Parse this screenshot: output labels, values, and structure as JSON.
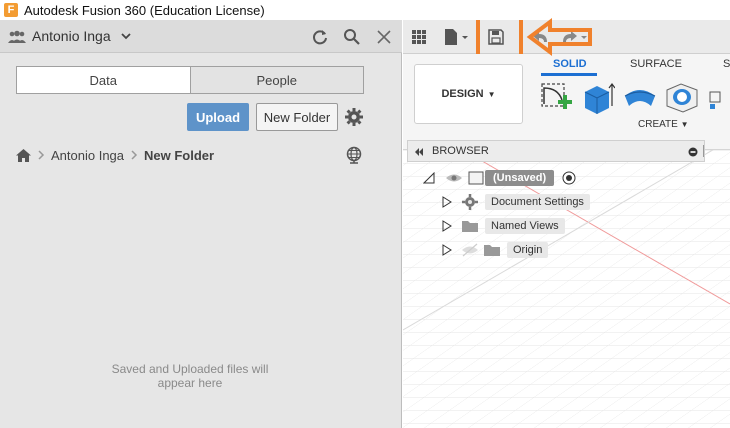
{
  "window": {
    "title": "Autodesk Fusion 360 (Education License)",
    "logo_letter": "F"
  },
  "data_panel": {
    "user_name": "Antonio Inga",
    "tabs": [
      {
        "label": "Data",
        "active": true
      },
      {
        "label": "People",
        "active": false
      }
    ],
    "upload_label": "Upload",
    "new_folder_label": "New Folder",
    "breadcrumb": [
      {
        "label": "Antonio Inga"
      },
      {
        "label": "New Folder"
      }
    ],
    "empty_message_line1": "Saved and Uploaded files will",
    "empty_message_line2": "appear here"
  },
  "toolbar": {
    "design_label": "DESIGN",
    "ribbon_tabs": [
      "SOLID",
      "SURFACE",
      "S"
    ],
    "create_label": "CREATE"
  },
  "browser": {
    "title": "BROWSER",
    "root_label": "(Unsaved)",
    "items": [
      {
        "label": "Document Settings"
      },
      {
        "label": "Named Views"
      },
      {
        "label": "Origin"
      }
    ]
  },
  "colors": {
    "accent_orange": "#f0812c",
    "upload_blue": "#5e93c9",
    "ribbon_blue": "#1c6fd2"
  }
}
